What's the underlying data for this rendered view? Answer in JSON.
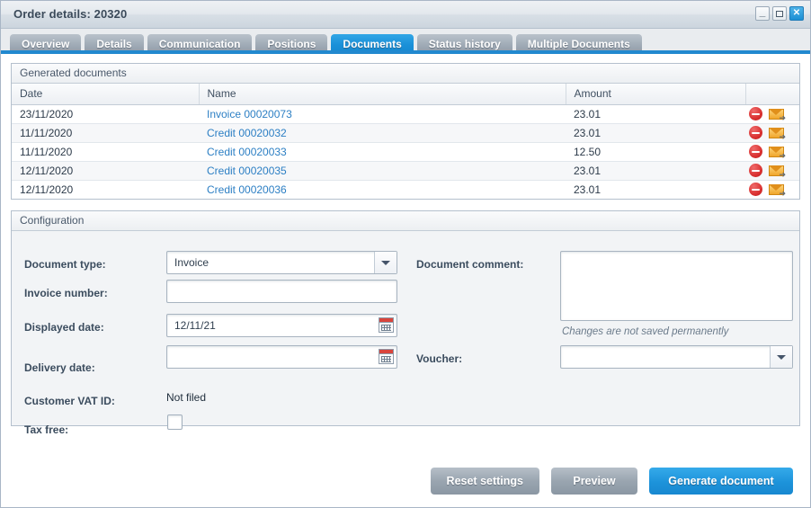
{
  "window": {
    "title": "Order details: 20320",
    "controls": [
      {
        "name": "minimize",
        "glyph": "–"
      },
      {
        "name": "maximize",
        "glyph": ""
      },
      {
        "name": "close",
        "glyph": "✕"
      }
    ]
  },
  "tabs": [
    {
      "label": "Overview",
      "active": false
    },
    {
      "label": "Details",
      "active": false
    },
    {
      "label": "Communication",
      "active": false
    },
    {
      "label": "Positions",
      "active": false
    },
    {
      "label": "Documents",
      "active": true
    },
    {
      "label": "Status history",
      "active": false
    },
    {
      "label": "Multiple Documents",
      "active": false
    }
  ],
  "generated_documents": {
    "panel_title": "Generated documents",
    "columns": [
      "Date",
      "Name",
      "Amount",
      ""
    ],
    "rows": [
      {
        "date": "23/11/2020",
        "name": "Invoice 00020073",
        "amount": "23.01"
      },
      {
        "date": "11/11/2020",
        "name": "Credit 00020032",
        "amount": "23.01"
      },
      {
        "date": "11/11/2020",
        "name": "Credit 00020033",
        "amount": "12.50"
      },
      {
        "date": "12/11/2020",
        "name": "Credit 00020035",
        "amount": "23.01"
      },
      {
        "date": "12/11/2020",
        "name": "Credit 00020036",
        "amount": "23.01"
      }
    ],
    "row_actions": [
      {
        "icon": "delete-icon",
        "tooltip": "delete"
      },
      {
        "icon": "send-mail-icon",
        "tooltip": "send"
      }
    ]
  },
  "configuration": {
    "panel_title": "Configuration",
    "labels": {
      "document_type": "Document type:",
      "invoice_number": "Invoice number:",
      "displayed_date": "Displayed date:",
      "delivery_date": "Delivery date:",
      "customer_vat_id": "Customer VAT ID:",
      "tax_free": "Tax free:",
      "document_comment": "Document comment:",
      "voucher": "Voucher:"
    },
    "values": {
      "document_type": "Invoice",
      "invoice_number": "",
      "displayed_date": "12/11/21",
      "delivery_date": "",
      "customer_vat_id": "Not filed",
      "tax_free_checked": false,
      "document_comment": "",
      "voucher": ""
    },
    "placeholders": {
      "invoice_number": "",
      "delivery_date": "",
      "document_comment": ""
    },
    "comment_hint": "Changes are not saved permanently"
  },
  "footer": {
    "reset_label": "Reset settings",
    "preview_label": "Preview",
    "generate_label": "Generate document"
  },
  "colors": {
    "accent_blue": "#1d93da",
    "tab_rule": "#2289cf",
    "link_blue": "#2c7fc4",
    "delete_red": "#d82e2e",
    "mail_orange": "#f0a62b",
    "panel_bg": "#f2f4f6",
    "tabstrip_bg": "#e9ecef"
  }
}
